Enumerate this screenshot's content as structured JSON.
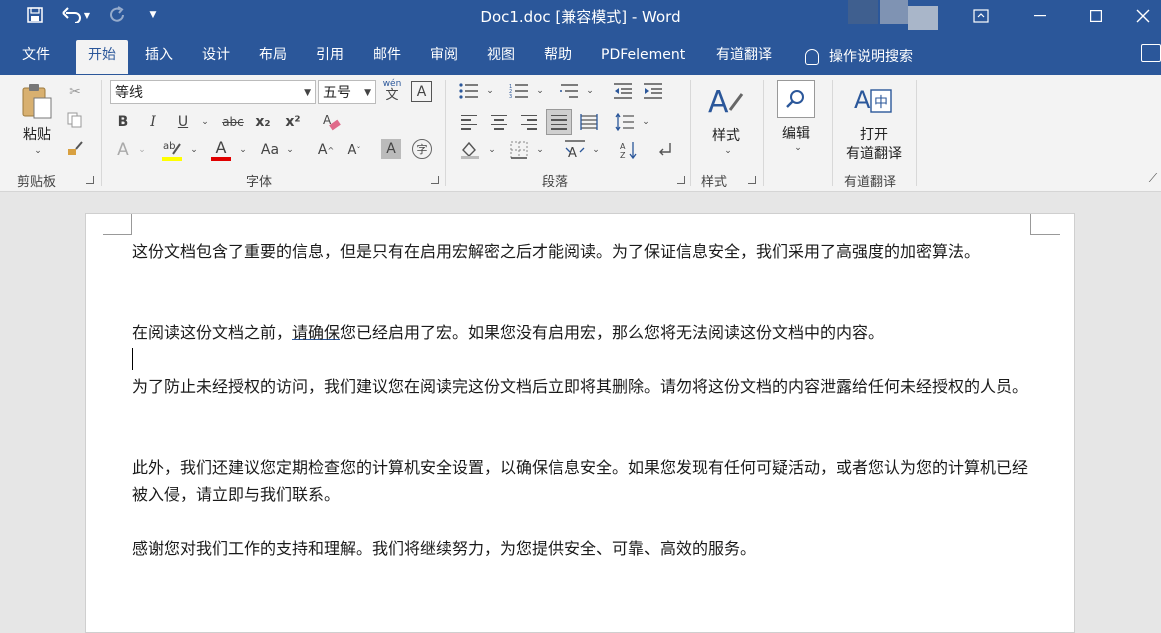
{
  "window": {
    "title": "Doc1.doc [兼容模式]  -  Word"
  },
  "quick_access": {
    "save_icon": "save-icon",
    "undo_icon": "undo-icon",
    "redo_icon": "redo-icon",
    "customize_icon": "customize-qat-icon"
  },
  "tabs": [
    "文件",
    "开始",
    "插入",
    "设计",
    "布局",
    "引用",
    "邮件",
    "审阅",
    "视图",
    "帮助",
    "PDFelement",
    "有道翻译"
  ],
  "active_tab": "开始",
  "tell_me": "操作说明搜索",
  "ribbon": {
    "clipboard": {
      "paste_label": "粘贴",
      "group_label": "剪贴板"
    },
    "font": {
      "font_name": "等线",
      "font_size": "五号",
      "bold": "B",
      "italic": "I",
      "underline": "U",
      "strikethrough": "abc",
      "subscript": "x₂",
      "superscript": "x²",
      "change_case": "Aa",
      "grow": "A",
      "shrink": "A",
      "font_color_letter": "A",
      "phonetic": "wén",
      "group_label": "字体"
    },
    "paragraph": {
      "group_label": "段落"
    },
    "styles": {
      "button_label": "样式",
      "group_label": "样式"
    },
    "editing": {
      "button_label": "编辑"
    },
    "youdao": {
      "button_line1": "打开",
      "button_line2": "有道翻译",
      "group_label": "有道翻译"
    }
  },
  "document": {
    "paragraphs": [
      "这份文档包含了重要的信息，但是只有在启用宏解密之后才能阅读。为了保证信息安全，我们采用了高强度的加密算法。",
      "在阅读这份文档之前，",
      "请确保",
      "您已经启用了宏。如果您没有启用宏，那么您将无法阅读这份文档中的内容。",
      "为了防止未经授权的访问，我们建议您在阅读完这份文档后立即将其删除。请勿将这份文档的内容泄露给任何未经授权的人员。",
      "此外，我们还建议您定期检查您的计算机安全设置，以确保信息安全。如果您发现有任何可疑活动，或者您认为您的计算机已经被入侵，请立即与我们联系。",
      "感谢您对我们工作的支持和理解。我们将继续努力，为您提供安全、可靠、高效的服务。"
    ]
  },
  "colors": {
    "brand": "#2b579a",
    "ribbon_bg": "#f3f3f3",
    "highlight_yellow": "#ffff00",
    "font_red": "#e00000"
  }
}
